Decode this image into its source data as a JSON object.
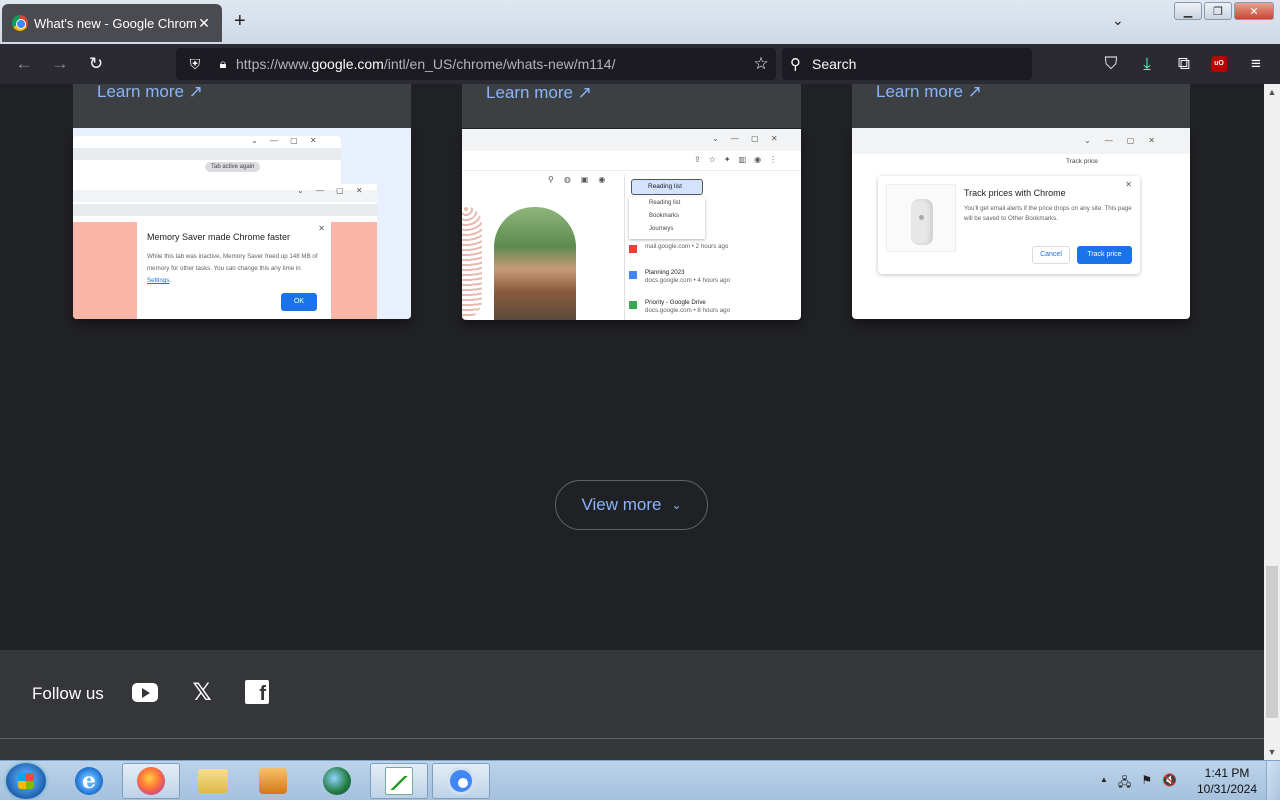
{
  "browser": {
    "tab_title": "What's new - Google Chrome",
    "tab_close": "✕",
    "new_tab": "+",
    "tab_list": "⌄",
    "window_minimize": "▁",
    "window_restore": "❐",
    "window_close": "✕"
  },
  "toolbar": {
    "back": "←",
    "forward": "→",
    "reload": "↻",
    "url_prefix": "https://www.",
    "url_host": "google.com",
    "url_path": "/intl/en_US/chrome/whats-new/m114/",
    "bookmark_star": "☆",
    "search_placeholder": "Search",
    "pocket": "⛉",
    "download": "⤓",
    "extensions": "⧉",
    "ublock": "uO",
    "menu": "≡"
  },
  "cards": [
    {
      "learn_more": "Learn more ↗",
      "dialog_title": "Memory Saver made Chrome faster",
      "dialog_text_1": "While this tab was inactive, Memory Saver freed up 148 MB of memory for other tasks. You can change this any time in ",
      "dialog_link": "Settings",
      "dialog_text_2": ".",
      "dialog_button": "OK",
      "pill_text": "Tab active again"
    },
    {
      "learn_more": "Learn more ↗",
      "panel_selector": "Reading list",
      "menu_items": [
        "Reading list",
        "Bookmarks",
        "Journeys"
      ],
      "list_items": [
        {
          "title": "",
          "sub": "mail.google.com • 2 hours ago"
        },
        {
          "title": "Planning 2023",
          "sub": "docs.google.com • 4 hours ago"
        },
        {
          "title": "Priority - Google Drive",
          "sub": "docs.google.com • 8 hours ago"
        }
      ]
    },
    {
      "learn_more": "Learn more ↗",
      "track_price_chip": "Track price",
      "dialog_title": "Track prices with Chrome",
      "dialog_text": "You'll get email alerts if the price drops on any site. This page will be saved to Other Bookmarks.",
      "cancel_button": "Cancel",
      "track_button": "Track price"
    }
  ],
  "view_more": {
    "label": "View more",
    "chevron": "⌄"
  },
  "footer": {
    "follow_us": "Follow us",
    "x_logo": "𝕏",
    "fb_logo": "f"
  },
  "taskbar": {
    "ie_glyph": "e",
    "clock_time": "1:41 PM",
    "clock_date": "10/31/2024",
    "tray_arrow": "▲",
    "tray_network": "🖧",
    "tray_flag": "⚑",
    "tray_volume": "🔇"
  },
  "colors": {
    "page_bg": "#202124",
    "card_header": "#3c4043",
    "link_blue": "#8ab4f8",
    "footer_bg": "#35363a",
    "button_blue": "#1a73e8"
  }
}
